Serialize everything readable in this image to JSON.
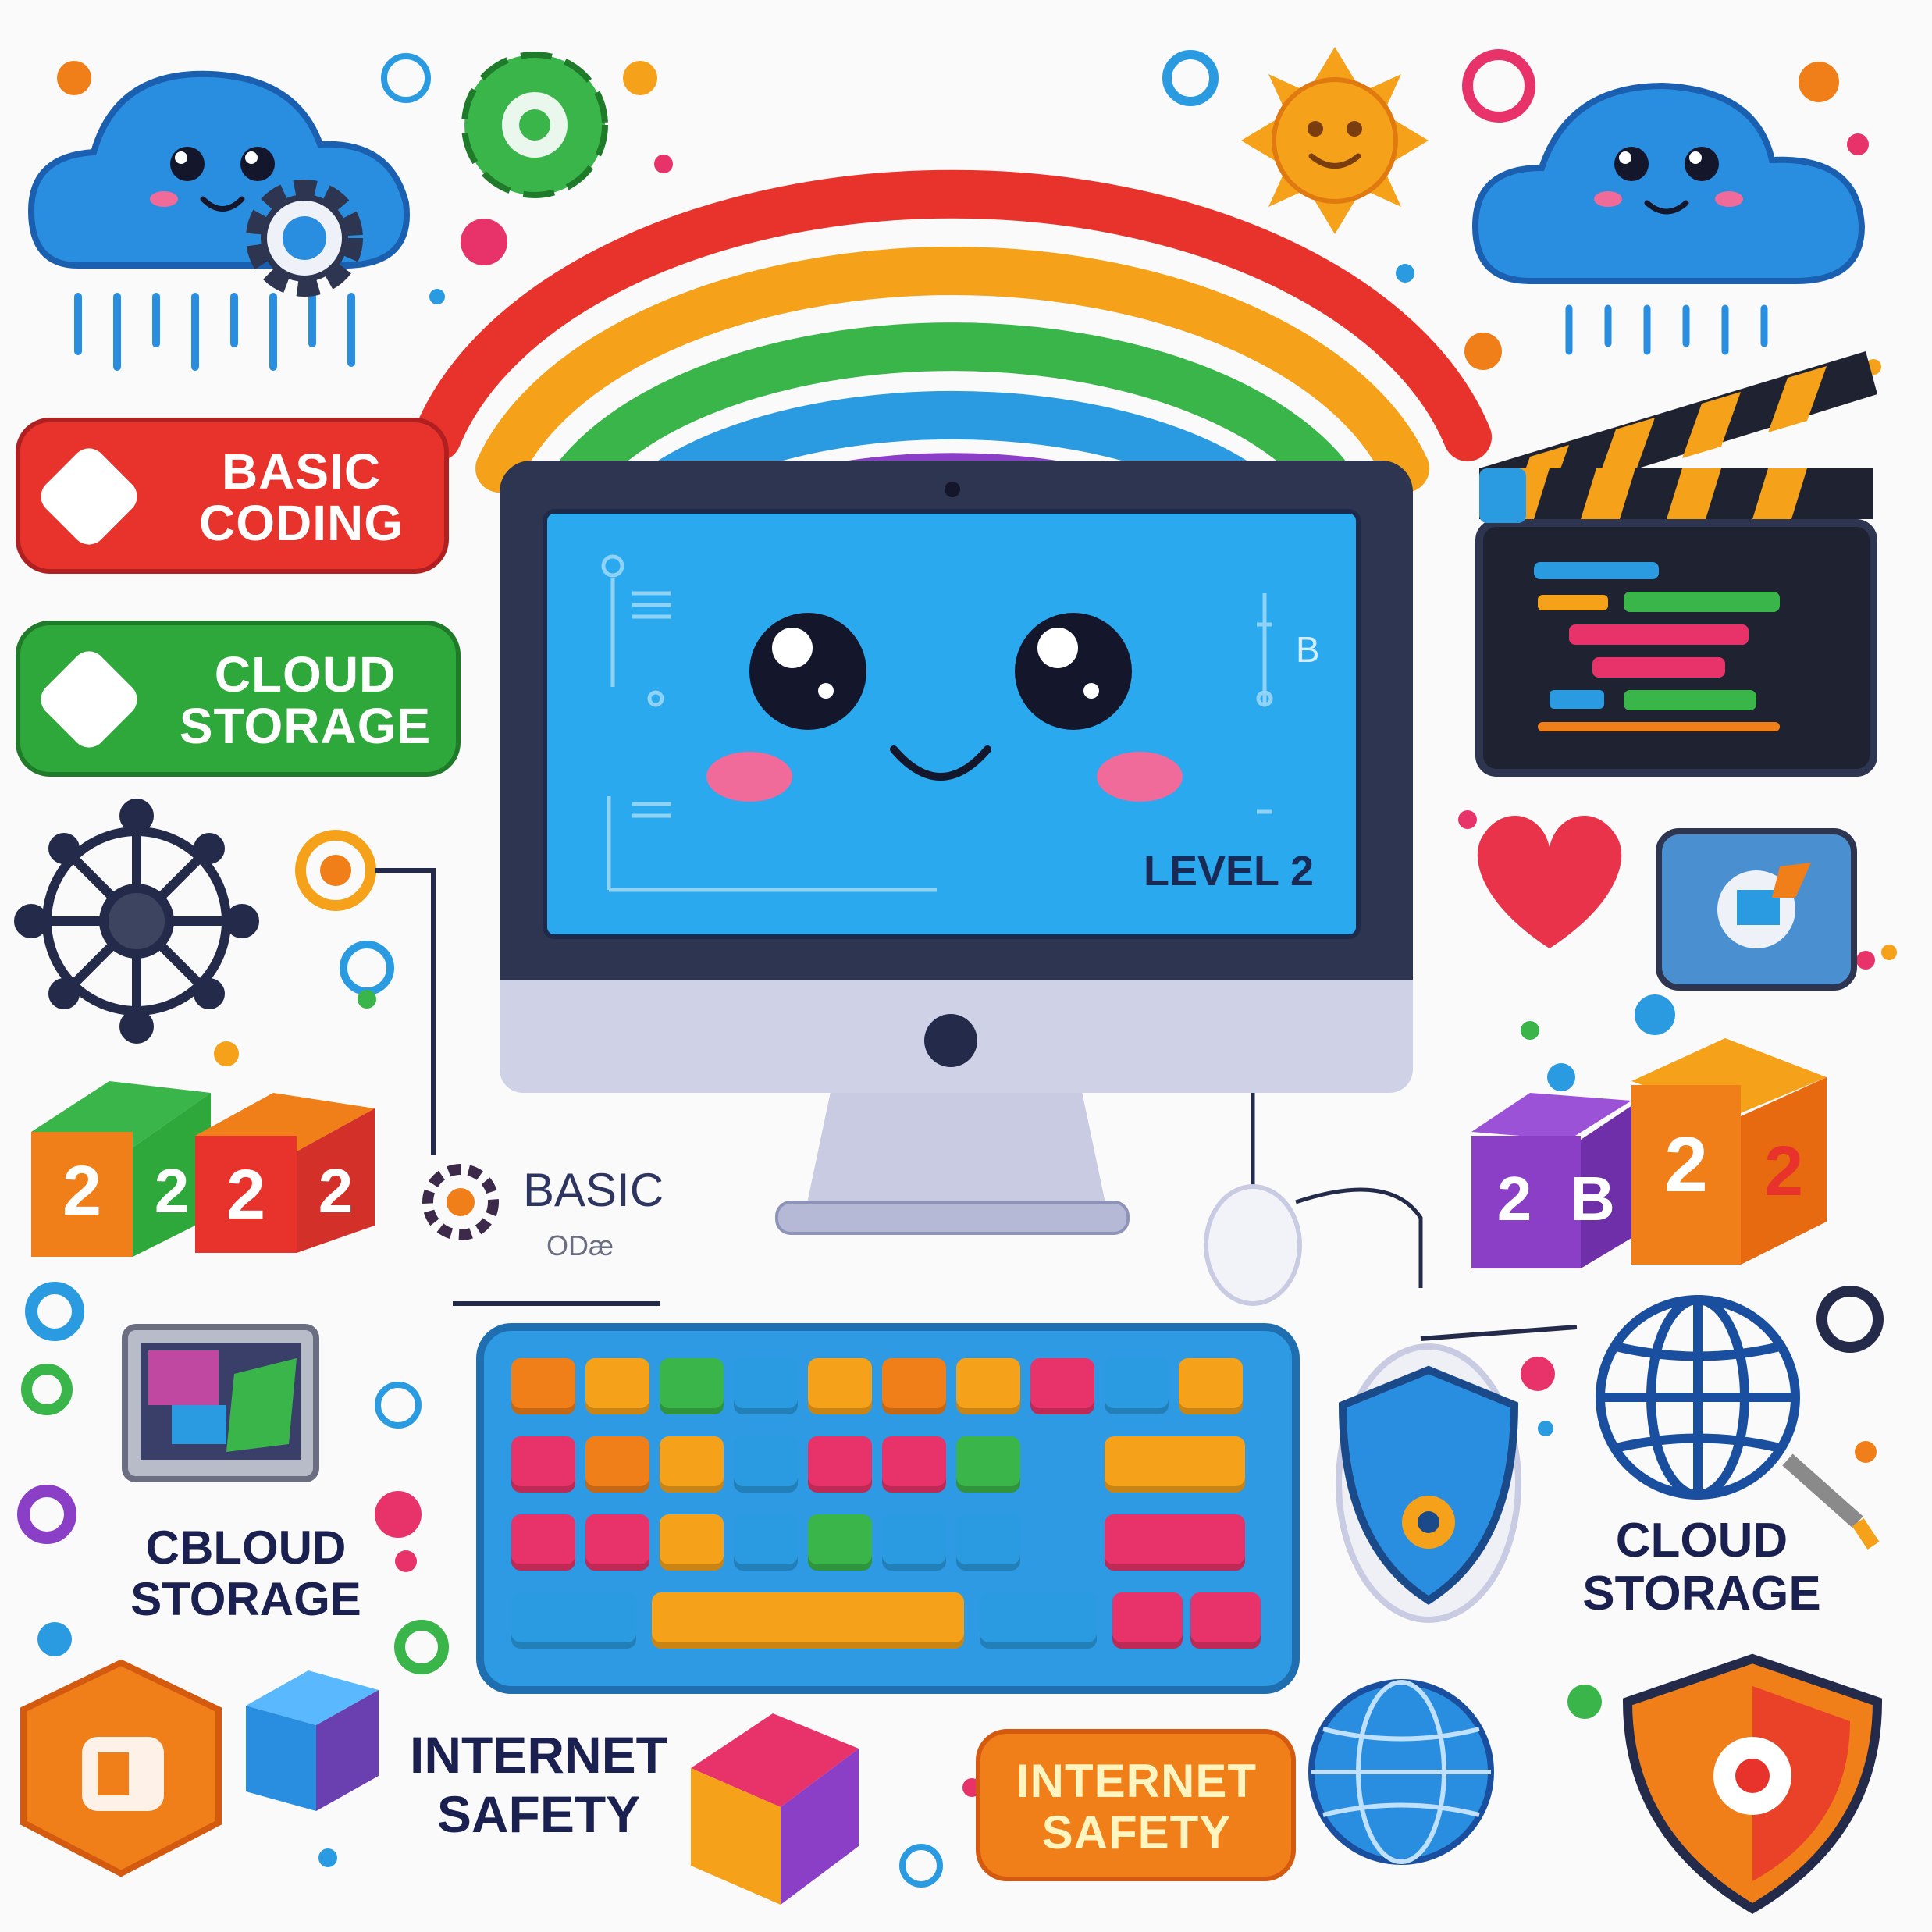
{
  "labels": {
    "basic_coding": "BASIC\nCODING",
    "cloud_storage_top": "CLOUD\nSTORAGE",
    "level": "LEVEL 2",
    "screen_b": "B",
    "basic_small": "BASIC",
    "odae": "ODæ",
    "cbloud_storage": "CBLOUD\nSTORAGE",
    "cloud_storage_right": "CLOUD\nSTORAGE",
    "internet_safety_left": "INTERNET\nSAFETY",
    "internet_safety_badge": "INTERNET\nSAFETY"
  },
  "cubes_left": [
    "2",
    "2",
    "2",
    "2"
  ],
  "cubes_right": [
    "2",
    "B",
    "2",
    "2"
  ],
  "colors": {
    "red": "#e8332c",
    "green": "#2ea83a",
    "orange": "#f07f1a",
    "blue": "#2a9be0",
    "navy": "#232a4a",
    "purple": "#8a3fc6",
    "screen": "#2aa9ef",
    "keyboard": "#2d9ae3"
  },
  "keyboard_rows": [
    [
      "#f07f1a",
      "#f5a21a",
      "#3ab54a",
      "#2a9be0",
      "#f5a21a",
      "#f07f1a",
      "#f5a21a",
      "#e8336a",
      "#2a9be0",
      "#f5a21a"
    ],
    [
      "#e8336a",
      "#f07f1a",
      "#f5a21a",
      "#2a9be0",
      "#e8336a",
      "#e8336a",
      "#3ab54a",
      "#f5a21a"
    ],
    [
      "#e8336a",
      "#e8336a",
      "#f5a21a",
      "#2a9be0",
      "#3ab54a",
      "#2a9be0",
      "#2a9be0",
      "#e8336a",
      "#e8336a"
    ]
  ],
  "icons": [
    "cloud-mascot-icon",
    "sun-mascot-icon",
    "gear-icon",
    "network-wheel-icon",
    "heart-icon",
    "clapperboard-icon",
    "globe-icon",
    "shield-icon",
    "mouse-icon",
    "tablet-icon",
    "cube-icon"
  ]
}
